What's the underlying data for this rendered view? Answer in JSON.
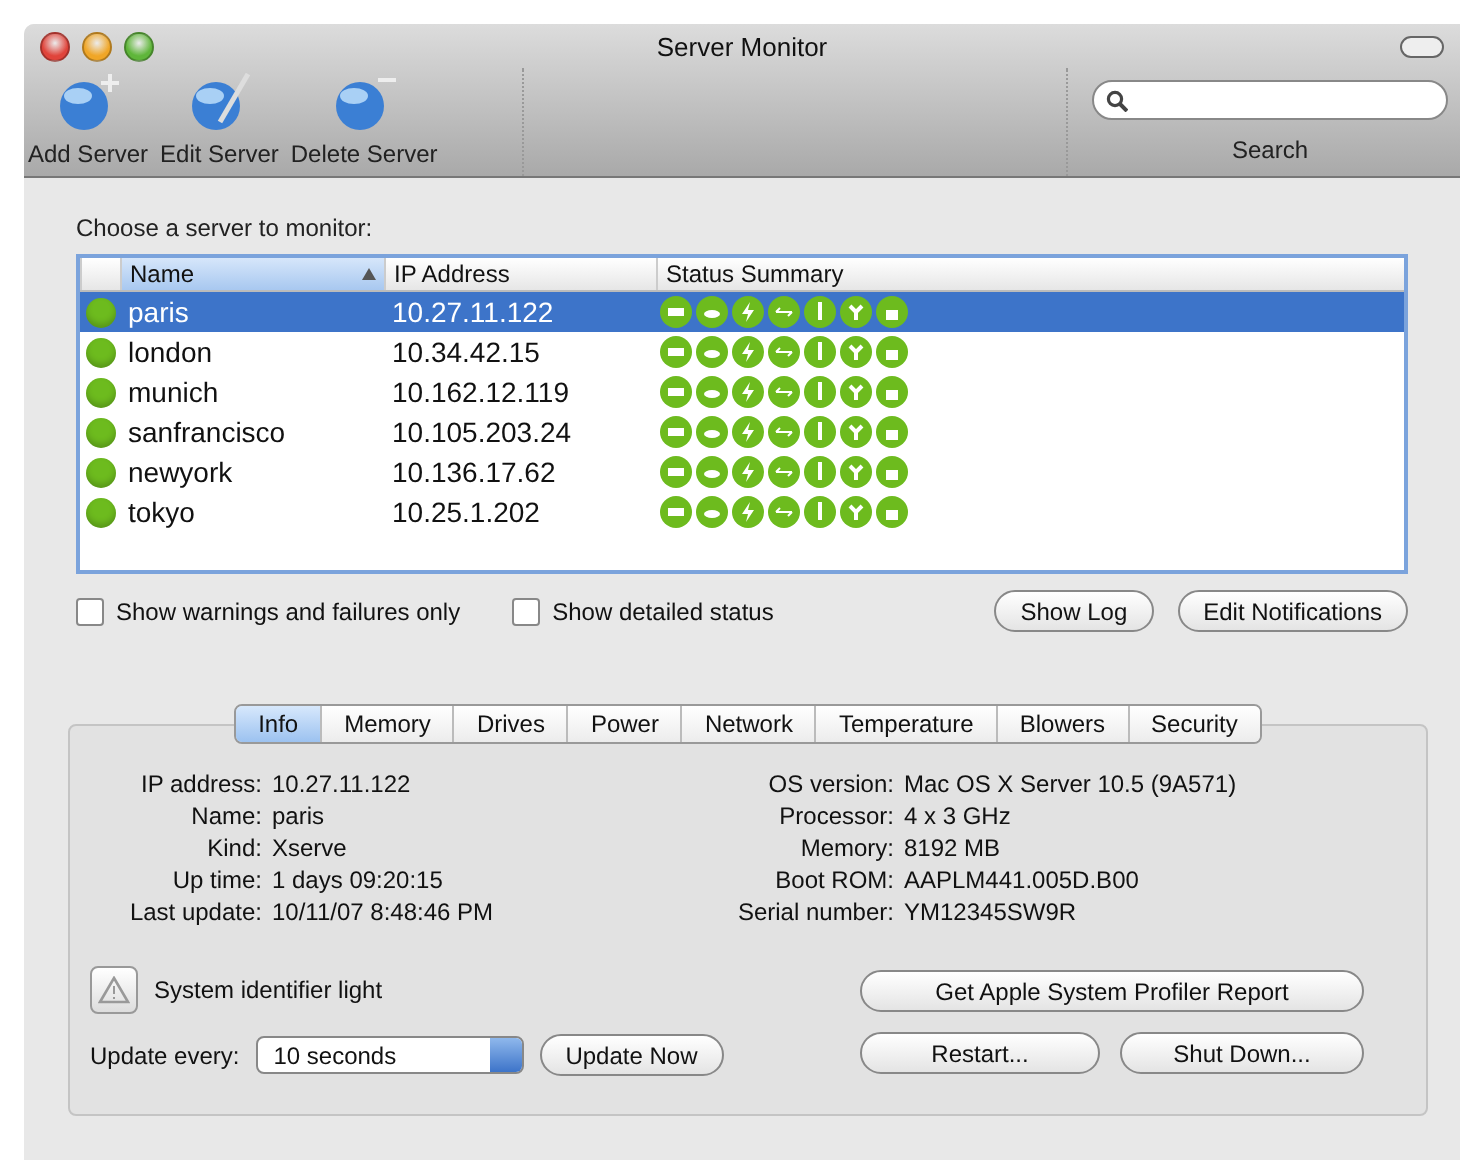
{
  "window": {
    "title": "Server Monitor"
  },
  "toolbar": {
    "buttons": [
      {
        "label": "Add Server",
        "kind": "add"
      },
      {
        "label": "Edit Server",
        "kind": "edit"
      },
      {
        "label": "Delete Server",
        "kind": "delete"
      }
    ],
    "search": {
      "label": "Search"
    }
  },
  "server_list": {
    "prompt": "Choose a server to monitor:",
    "columns": [
      "Name",
      "IP Address",
      "Status Summary"
    ],
    "rows": [
      {
        "name": "paris",
        "ip": "10.27.11.122",
        "selected": true
      },
      {
        "name": "london",
        "ip": "10.34.42.15",
        "selected": false
      },
      {
        "name": "munich",
        "ip": "10.162.12.119",
        "selected": false
      },
      {
        "name": "sanfrancisco",
        "ip": "10.105.203.24",
        "selected": false
      },
      {
        "name": "newyork",
        "ip": "10.136.17.62",
        "selected": false
      },
      {
        "name": "tokyo",
        "ip": "10.25.1.202",
        "selected": false
      }
    ]
  },
  "options": [
    {
      "label": "Show warnings and failures only",
      "checked": false
    },
    {
      "label": "Show detailed status",
      "checked": false
    }
  ],
  "list_buttons": [
    "Show Log",
    "Edit Notifications"
  ],
  "tabs": [
    {
      "label": "Info",
      "selected": true
    },
    {
      "label": "Memory",
      "selected": false
    },
    {
      "label": "Drives",
      "selected": false
    },
    {
      "label": "Power",
      "selected": false
    },
    {
      "label": "Network",
      "selected": false
    },
    {
      "label": "Temperature",
      "selected": false
    },
    {
      "label": "Blowers",
      "selected": false
    },
    {
      "label": "Security",
      "selected": false
    }
  ],
  "info_left": [
    {
      "label": "IP address:",
      "value": "10.27.11.122"
    },
    {
      "label": "Name:",
      "value": "paris"
    },
    {
      "label": "Kind:",
      "value": "Xserve"
    },
    {
      "label": "Up time:",
      "value": "1 days 09:20:15"
    },
    {
      "label": "Last update:",
      "value": "10/11/07 8:48:46 PM"
    }
  ],
  "info_right": [
    {
      "label": "OS version:",
      "value": "Mac OS X Server 10.5 (9A571)"
    },
    {
      "label": "Processor:",
      "value": "4 x 3 GHz"
    },
    {
      "label": "Memory:",
      "value": "8192 MB"
    },
    {
      "label": "Boot ROM:",
      "value": "AAPLM441.005D.B00"
    },
    {
      "label": "Serial number:",
      "value": "YM12345SW9R"
    }
  ],
  "identifier_light": {
    "label": "System identifier light"
  },
  "update": {
    "label": "Update every:",
    "value": "10 seconds",
    "button": "Update Now"
  },
  "actions": [
    "Get Apple System Profiler Report",
    "Restart...",
    "Shut Down..."
  ]
}
